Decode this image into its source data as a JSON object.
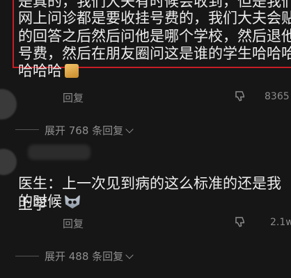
{
  "top_comment": {
    "lines": [
      "是真的，我们大夫有时候会收到，但是我们",
      "网上问诊都是要收挂号费的，我们大夫会贴",
      "的回答之后然后问他是哪个学校，然后退他",
      "号费，然后在朋友圈问这是谁的学生哈哈哈",
      "哈哈哈"
    ],
    "emoji_icon": "cat-emoji",
    "reply_label": "回复",
    "like_count": "8365"
  },
  "expand_1": {
    "label": "展开 768 条回复"
  },
  "second_comment": {
    "lines": [
      "医生：上一次见到病的这么标准的还是我上学",
      "的时候"
    ],
    "emoji_icon": "fox-emoji",
    "reply_label": "回复",
    "like_count": "2.1w"
  },
  "expand_2": {
    "label": "展开 488 条回复"
  },
  "colors": {
    "background": "#161616",
    "highlight_border": "#c81d25",
    "text": "#ececec",
    "muted": "#8b8b8b"
  }
}
